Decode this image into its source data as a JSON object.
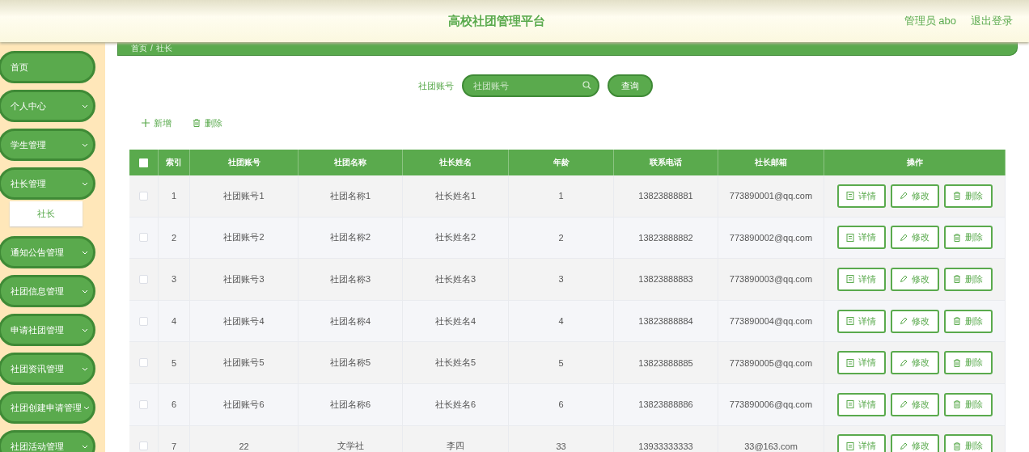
{
  "header": {
    "title": "高校社团管理平台",
    "user": "管理员 abo",
    "logout": "退出登录"
  },
  "sidebar": {
    "items": [
      {
        "label": "首页",
        "expandable": false
      },
      {
        "label": "个人中心",
        "expandable": true
      },
      {
        "label": "学生管理",
        "expandable": true
      },
      {
        "label": "社长管理",
        "expandable": true,
        "children": [
          {
            "label": "社长",
            "selected": true
          }
        ]
      },
      {
        "label": "通知公告管理",
        "expandable": true
      },
      {
        "label": "社团信息管理",
        "expandable": true
      },
      {
        "label": "申请社团管理",
        "expandable": true
      },
      {
        "label": "社团资讯管理",
        "expandable": true
      },
      {
        "label": "社团创建申请管理",
        "expandable": true
      },
      {
        "label": "社团活动管理",
        "expandable": true
      }
    ]
  },
  "breadcrumb": [
    "首页",
    "/",
    "社长"
  ],
  "search": {
    "label": "社团账号",
    "placeholder": "社团账号",
    "button": "查询"
  },
  "toolbar": [
    {
      "label": "新增",
      "kind": "add"
    },
    {
      "label": "删除",
      "kind": "delete"
    }
  ],
  "table": {
    "header_checked": false,
    "columns": [
      "索引",
      "社团账号",
      "社团名称",
      "社长姓名",
      "年龄",
      "联系电话",
      "社长邮箱",
      "操作"
    ],
    "rows": [
      {
        "selected": false,
        "cells": [
          "1",
          "社团账号1",
          "社团名称1",
          "社长姓名1",
          "1",
          "13823888881",
          "773890001@qq.com"
        ],
        "actions": [
          {
            "label": "详情",
            "kind": "detail"
          },
          {
            "label": "修改",
            "kind": "edit"
          },
          {
            "label": "删除",
            "kind": "delete"
          }
        ]
      },
      {
        "selected": false,
        "cells": [
          "2",
          "社团账号2",
          "社团名称2",
          "社长姓名2",
          "2",
          "13823888882",
          "773890002@qq.com"
        ],
        "actions": [
          {
            "label": "详情",
            "kind": "detail"
          },
          {
            "label": "修改",
            "kind": "edit"
          },
          {
            "label": "删除",
            "kind": "delete"
          }
        ]
      },
      {
        "selected": false,
        "cells": [
          "3",
          "社团账号3",
          "社团名称3",
          "社长姓名3",
          "3",
          "13823888883",
          "773890003@qq.com"
        ],
        "actions": [
          {
            "label": "详情",
            "kind": "detail"
          },
          {
            "label": "修改",
            "kind": "edit"
          },
          {
            "label": "删除",
            "kind": "delete"
          }
        ]
      },
      {
        "selected": false,
        "cells": [
          "4",
          "社团账号4",
          "社团名称4",
          "社长姓名4",
          "4",
          "13823888884",
          "773890004@qq.com"
        ],
        "actions": [
          {
            "label": "详情",
            "kind": "detail"
          },
          {
            "label": "修改",
            "kind": "edit"
          },
          {
            "label": "删除",
            "kind": "delete"
          }
        ]
      },
      {
        "selected": false,
        "cells": [
          "5",
          "社团账号5",
          "社团名称5",
          "社长姓名5",
          "5",
          "13823888885",
          "773890005@qq.com"
        ],
        "actions": [
          {
            "label": "详情",
            "kind": "detail"
          },
          {
            "label": "修改",
            "kind": "edit"
          },
          {
            "label": "删除",
            "kind": "delete"
          }
        ]
      },
      {
        "selected": false,
        "cells": [
          "6",
          "社团账号6",
          "社团名称6",
          "社长姓名6",
          "6",
          "13823888886",
          "773890006@qq.com"
        ],
        "actions": [
          {
            "label": "详情",
            "kind": "detail"
          },
          {
            "label": "修改",
            "kind": "edit"
          },
          {
            "label": "删除",
            "kind": "delete"
          }
        ]
      },
      {
        "selected": false,
        "cells": [
          "7",
          "22",
          "文学社",
          "李四",
          "33",
          "13933333333",
          "33@163.com"
        ],
        "actions": [
          {
            "label": "详情",
            "kind": "detail"
          },
          {
            "label": "修改",
            "kind": "edit"
          },
          {
            "label": "删除",
            "kind": "delete"
          }
        ]
      }
    ]
  }
}
